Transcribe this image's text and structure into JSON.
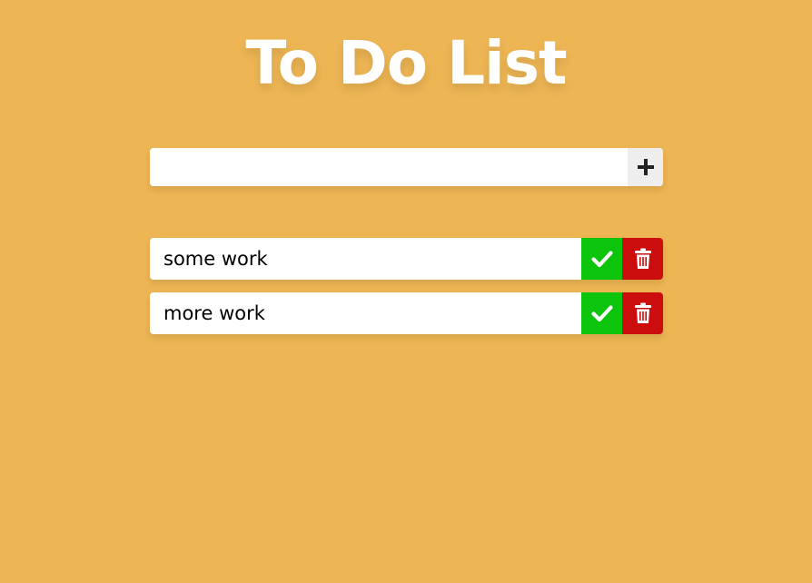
{
  "header": {
    "title": "To Do List"
  },
  "add_form": {
    "input_value": "",
    "add_icon": "plus-icon"
  },
  "todos": [
    {
      "text": "some work",
      "complete_icon": "check-icon",
      "delete_icon": "trash-icon"
    },
    {
      "text": "more work",
      "complete_icon": "check-icon",
      "delete_icon": "trash-icon"
    }
  ],
  "colors": {
    "background": "#EDB553",
    "complete": "#0BC40B",
    "delete": "#CC0D0D",
    "add_button": "#EEEEEE"
  }
}
